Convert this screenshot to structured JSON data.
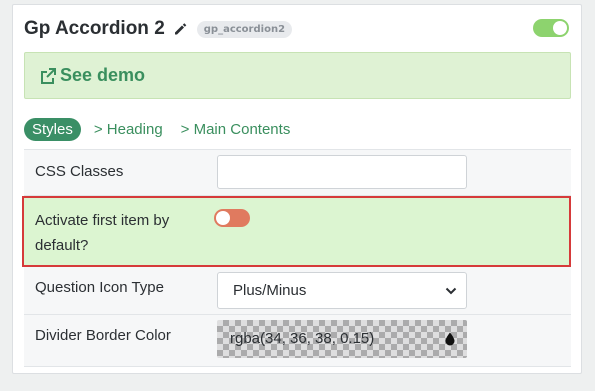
{
  "header": {
    "title": "Gp Accordion 2",
    "slug": "gp_accordion2",
    "enabled": true
  },
  "demo": {
    "label": "See demo"
  },
  "tabs": [
    {
      "label": "Styles",
      "active": true
    },
    {
      "label": "> Heading",
      "active": false
    },
    {
      "label": "> Main Contents",
      "active": false
    }
  ],
  "fields": {
    "css_classes": {
      "label": "CSS Classes",
      "value": ""
    },
    "activate_first": {
      "label": "Activate first item by default?",
      "enabled": false
    },
    "question_icon": {
      "label": "Question Icon Type",
      "value": "Plus/Minus"
    },
    "divider_color": {
      "label": "Divider Border Color",
      "value": "rgba(34, 36, 38, 0.15)"
    }
  },
  "colors": {
    "accent": "#3a8f66",
    "toggle_on": "#8dd36e",
    "toggle_off": "#e07a5f",
    "highlight_bg": "#dcf5d1",
    "highlight_border": "#d63a3a"
  }
}
